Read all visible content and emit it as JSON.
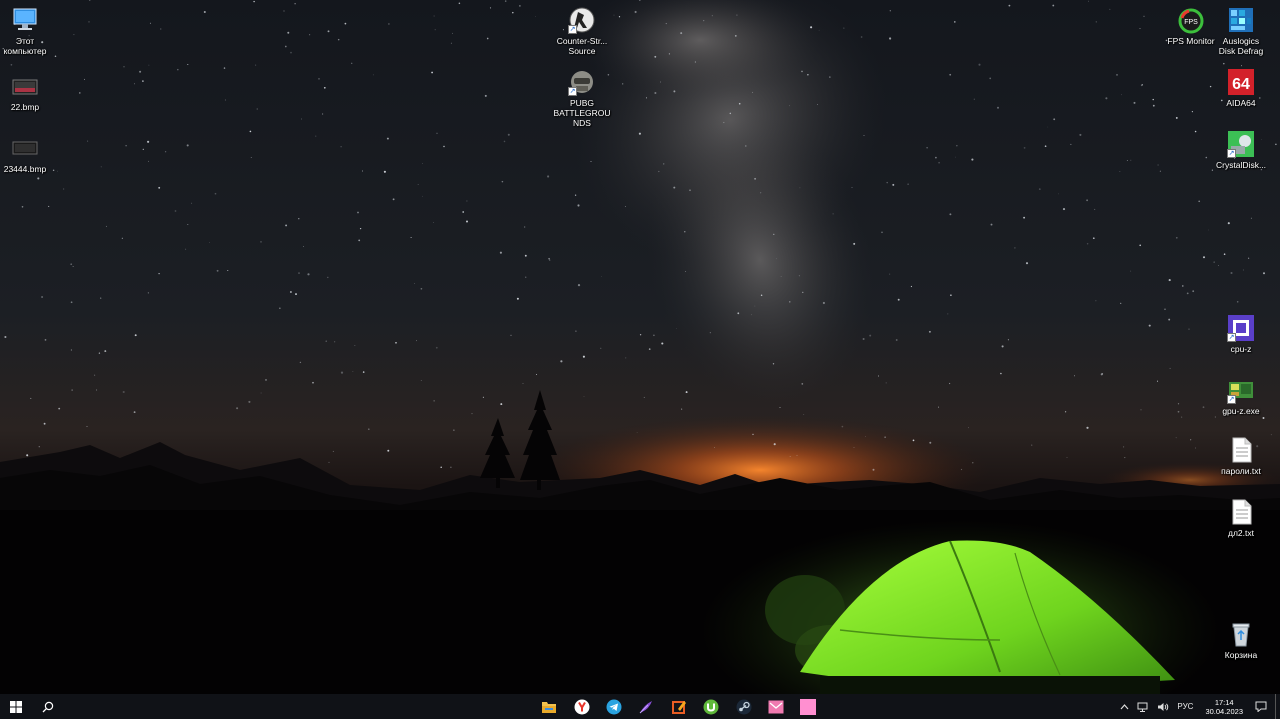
{
  "desktop": {
    "icons_left": [
      {
        "label": "Этот\nкомпьютер",
        "icon": "computer-icon"
      },
      {
        "label": "22.bmp",
        "icon": "bmp-file-icon"
      },
      {
        "label": "23444.bmp",
        "icon": "bmp-file-icon"
      }
    ],
    "icons_center": [
      {
        "label": "Counter-Str...\nSource",
        "icon": "counter-strike-icon"
      },
      {
        "label": "PUBG\nBATTLEGROU\nNDS",
        "icon": "pubg-icon"
      }
    ],
    "icons_right": [
      {
        "label": "FPS Monitor",
        "icon": "fps-monitor-icon"
      },
      {
        "label": "Auslogics\nDisk Defrag",
        "icon": "disk-defrag-icon"
      },
      {
        "label": "AIDA64",
        "icon": "aida64-icon",
        "badge": "64"
      },
      {
        "label": "CrystalDisk...",
        "icon": "crystaldisk-icon"
      },
      {
        "label": "cpu-z",
        "icon": "cpu-z-icon"
      },
      {
        "label": "gpu-z.exe",
        "icon": "gpu-z-icon"
      },
      {
        "label": "пароли.txt",
        "icon": "text-file-icon"
      },
      {
        "label": "дл2.txt",
        "icon": "text-file-icon"
      },
      {
        "label": "Корзина",
        "icon": "recycle-bin-icon"
      }
    ],
    "fps_badge": "FPS"
  },
  "taskbar": {
    "pinned": [
      {
        "name": "file-explorer",
        "icon": "folder-icon",
        "color": "#f2c14e"
      },
      {
        "name": "yandex-browser",
        "icon": "yandex-icon",
        "color": "#e8342a"
      },
      {
        "name": "telegram",
        "icon": "telegram-icon",
        "color": "#2aa3e0"
      },
      {
        "name": "feather-app",
        "icon": "feather-icon",
        "color": "#8a4fd8"
      },
      {
        "name": "photo-editor",
        "icon": "edit-app-icon",
        "color": "#e85d24"
      },
      {
        "name": "utorrent",
        "icon": "utorrent-icon",
        "color": "#5fb83a"
      },
      {
        "name": "steam",
        "icon": "steam-icon",
        "color": "#c6d4df"
      },
      {
        "name": "mail-app",
        "icon": "mail-icon",
        "color": "#f07ab0"
      },
      {
        "name": "pink-app",
        "icon": "pink-square-icon",
        "color": "#ff8fd0"
      }
    ],
    "tray": {
      "language": "РУС",
      "time": "17:14",
      "date": "30.04.2023"
    }
  }
}
